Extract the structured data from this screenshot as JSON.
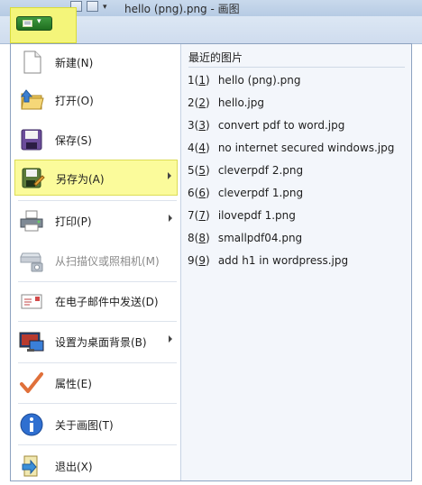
{
  "window": {
    "title": "hello (png).png - 画图"
  },
  "app_menu_button": {
    "icon": "paint-document-icon",
    "caret": "▾"
  },
  "menu": {
    "items": [
      {
        "label": "新建(N)",
        "icon": "new-document-icon",
        "enabled": true,
        "submenu": false
      },
      {
        "label": "打开(O)",
        "icon": "open-folder-icon",
        "enabled": true,
        "submenu": false
      },
      {
        "label": "保存(S)",
        "icon": "save-disk-icon",
        "enabled": true,
        "submenu": false
      },
      {
        "label": "另存为(A)",
        "icon": "save-as-icon",
        "enabled": true,
        "submenu": true,
        "highlighted": true
      },
      {
        "label": "打印(P)",
        "icon": "printer-icon",
        "enabled": true,
        "submenu": true
      },
      {
        "label": "从扫描仪或照相机(M)",
        "icon": "scanner-camera-icon",
        "enabled": false,
        "submenu": false
      },
      {
        "label": "在电子邮件中发送(D)",
        "icon": "email-icon",
        "enabled": true,
        "submenu": false
      },
      {
        "label": "设置为桌面背景(B)",
        "icon": "desktop-background-icon",
        "enabled": true,
        "submenu": true
      },
      {
        "label": "属性(E)",
        "icon": "checkmark-icon",
        "enabled": true,
        "submenu": false
      },
      {
        "label": "关于画图(T)",
        "icon": "info-icon",
        "enabled": true,
        "submenu": false
      },
      {
        "label": "退出(X)",
        "icon": "exit-icon",
        "enabled": true,
        "submenu": false
      }
    ]
  },
  "recent": {
    "title": "最近的图片",
    "files": [
      {
        "num": "1",
        "name": "hello (png).png"
      },
      {
        "num": "2",
        "name": "hello.jpg"
      },
      {
        "num": "3",
        "name": "convert pdf to word.jpg"
      },
      {
        "num": "4",
        "name": "no internet secured windows.jpg"
      },
      {
        "num": "5",
        "name": "cleverpdf 2.png"
      },
      {
        "num": "6",
        "name": "cleverpdf 1.png"
      },
      {
        "num": "7",
        "name": "ilovepdf 1.png"
      },
      {
        "num": "8",
        "name": "smallpdf04.png"
      },
      {
        "num": "9",
        "name": "add h1 in wordpress.jpg"
      }
    ]
  },
  "colors": {
    "highlight": "#fbfb9b",
    "app_button": "#f4f57a",
    "menu_border": "#8da2c0"
  }
}
